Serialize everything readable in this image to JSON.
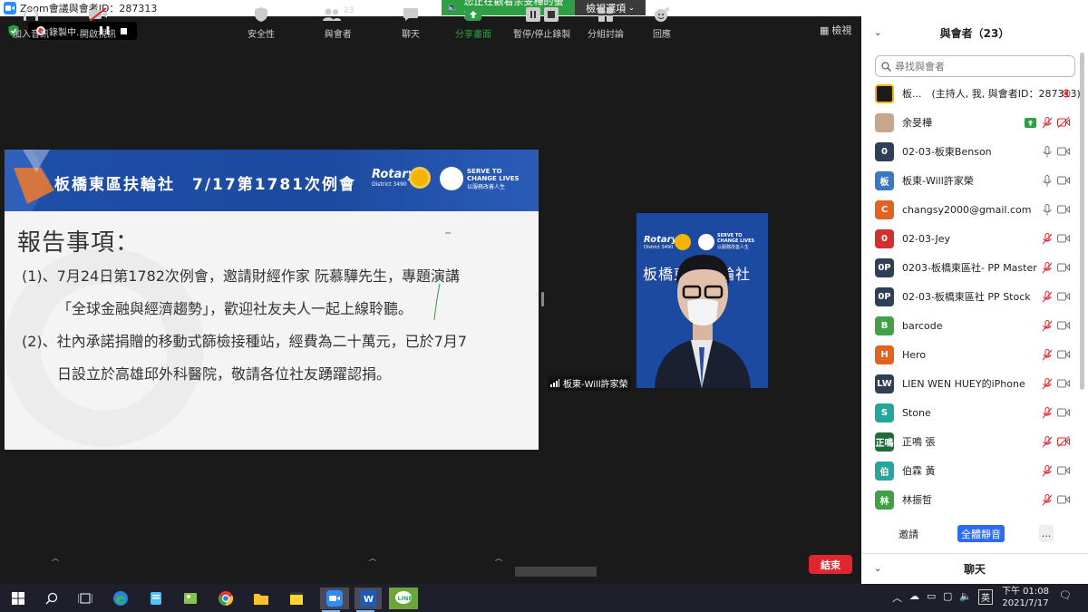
{
  "window": {
    "title": "Zoom會議與會者ID：287313"
  },
  "banner": {
    "viewing_text": "您正在觀看余旻樺的螢幕",
    "view_options": "檢視選項"
  },
  "recording": {
    "status": "錄製中..."
  },
  "view_button": "檢視",
  "slide": {
    "header_title": "板橋東區扶輪社　7/17第1781次例會",
    "rotary": "Rotary",
    "district": "District 3490",
    "serve_line1": "SERVE TO",
    "serve_line2": "CHANGE LIVES",
    "serve_line3": "以服務改善人生",
    "report_title": "報告事項：",
    "item1_line1": "(1)、7月24日第1782次例會，邀請財經作家 阮慕驊先生，專題演講",
    "item1_line2": "「全球金融與經濟趨勢」，歡迎社友夫人一起上線聆聽。",
    "item2_line1": "(2)、社內承諾捐贈的移動式篩檢接種站，經費為二十萬元，已於7月7",
    "item2_line2": "日設立於高雄邱外科醫院，敬請各位社友踴躍認捐。"
  },
  "speaker_tile": {
    "name_label": "板東-Will許家榮",
    "background_text": "板橋東區扶輪社",
    "rotary": "Rotary",
    "district": "District 3490",
    "serve_line1": "SERVE TO",
    "serve_line2": "CHANGE LIVES",
    "serve_line3": "以服務改善人生"
  },
  "toolbar": {
    "join_audio": "加入音訊",
    "start_video": "開啟視訊",
    "security": "安全性",
    "participants": "與會者",
    "participants_count": "23",
    "chat": "聊天",
    "share_screen": "分享畫面",
    "pause_stop_recording": "暫停/停止錄製",
    "breakout": "分組討論",
    "reactions": "回應",
    "end": "結束"
  },
  "panel": {
    "title": "與會者（23）",
    "search_placeholder": "尋找與會者",
    "participants": [
      {
        "initials": "",
        "name": "板...　(主持人, 我, 與會者ID：287313)",
        "color": "#2b2b2b"
      },
      {
        "initials": "",
        "name": "余旻樺",
        "color": "#c9a58c"
      },
      {
        "initials": "0",
        "name": "02-03-板東Benson",
        "color": "#2f3f55"
      },
      {
        "initials": "板",
        "name": "板東-Will許家榮",
        "color": "#3a78c2"
      },
      {
        "initials": "C",
        "name": "changsy2000@gmail.com",
        "color": "#e0641f"
      },
      {
        "initials": "0",
        "name": "02-03-Jey",
        "color": "#d32f2f"
      },
      {
        "initials": "0P",
        "name": "0203-板橋東區社- PP Master",
        "color": "#2f3f55"
      },
      {
        "initials": "0P",
        "name": "02-03-板橋東區社 PP Stock",
        "color": "#2f3f55"
      },
      {
        "initials": "B",
        "name": "barcode",
        "color": "#43a047"
      },
      {
        "initials": "H",
        "name": "Hero",
        "color": "#e0641f"
      },
      {
        "initials": "LW",
        "name": "LIEN WEN HUEY的iPhone",
        "color": "#2f3f55"
      },
      {
        "initials": "S",
        "name": "Stone",
        "color": "#26a69a"
      },
      {
        "initials": "正鳴",
        "name": "正鳴 張",
        "color": "#1e6e3a"
      },
      {
        "initials": "伯",
        "name": "伯霖 黃",
        "color": "#26a69a"
      },
      {
        "initials": "林",
        "name": "林振哲",
        "color": "#43a047"
      }
    ],
    "invite": "邀請",
    "mute_all": "全體靜音",
    "more": "...",
    "chat_title": "聊天"
  },
  "taskbar": {
    "time": "下午 01:08",
    "date": "2021/7/17",
    "ime": "英"
  }
}
